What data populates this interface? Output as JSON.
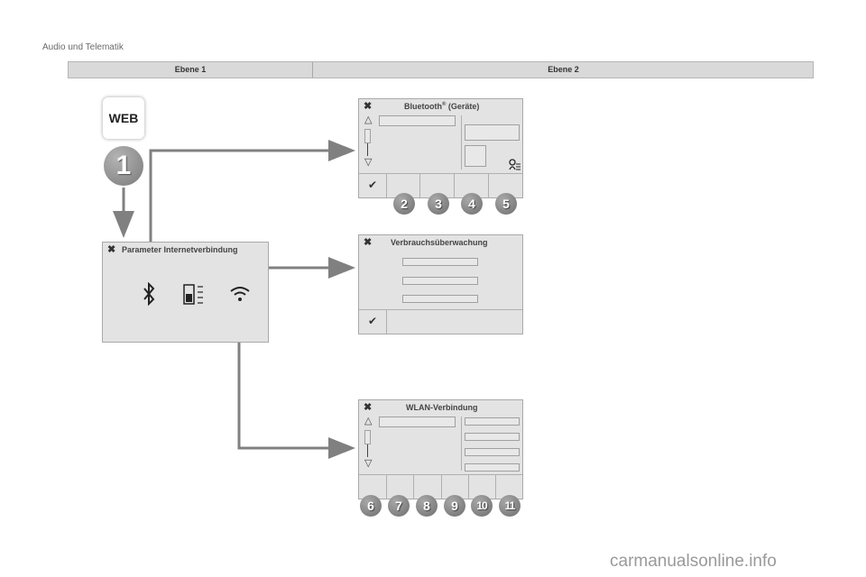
{
  "header": {
    "section_title": "Audio und Telematik"
  },
  "levels": {
    "level1": "Ebene 1",
    "level2": "Ebene 2"
  },
  "web_icon": {
    "label": "WEB"
  },
  "step1": {
    "label": "1"
  },
  "panel_params": {
    "title": "Parameter Internetverbindung"
  },
  "panel_bluetooth": {
    "title_main": "Bluetooth",
    "title_sup": "®",
    "title_rest": " (Geräte)"
  },
  "panel_usage": {
    "title": "Verbrauchsüberwachung"
  },
  "panel_wlan": {
    "title": "WLAN-Verbindung"
  },
  "icons": {
    "close": "✖",
    "check": "✔",
    "up": "△",
    "down": "▽",
    "bluetooth": "bluetooth-icon",
    "data_usage": "data-usage-icon",
    "wifi": "wifi-icon",
    "device_list": "device-list-icon"
  },
  "badges_bluetooth": [
    "2",
    "3",
    "4",
    "5"
  ],
  "badges_wlan": [
    "6",
    "7",
    "8",
    "9",
    "10",
    "11"
  ],
  "watermark": "carmanualsonline.info",
  "colors": {
    "panel": "#e3e3e3",
    "badge": "#808080",
    "arrow": "#808080"
  }
}
